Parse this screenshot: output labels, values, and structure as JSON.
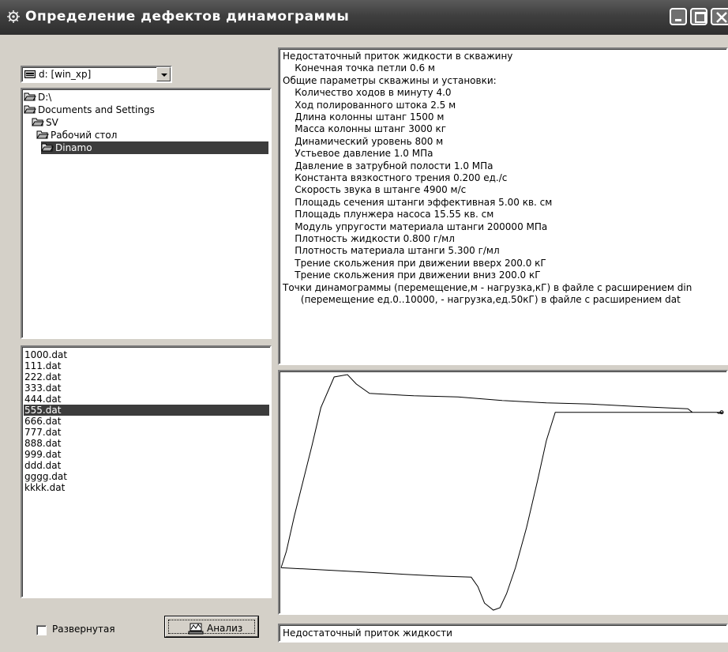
{
  "window": {
    "title": "Определение дефектов динамограммы",
    "colors": {
      "titlebar": "#3f3f3f",
      "face": "#d4d0c8",
      "selection": "#3c3c3c"
    }
  },
  "drive": {
    "value": "d: [win_xp]",
    "icon": "drive-icon"
  },
  "directories": [
    {
      "label": "D:\\",
      "icon": "folder-open-icon",
      "selected": false
    },
    {
      "label": "Documents and Settings",
      "icon": "folder-open-icon",
      "selected": false
    },
    {
      "label": "SV",
      "icon": "folder-open-icon",
      "selected": false
    },
    {
      "label": "Рабочий стол",
      "icon": "folder-open-icon",
      "selected": false
    },
    {
      "label": "Dinamo",
      "icon": "folder-open-icon",
      "selected": true
    }
  ],
  "files": [
    {
      "name": "1000.dat",
      "selected": false
    },
    {
      "name": "111.dat",
      "selected": false
    },
    {
      "name": "222.dat",
      "selected": false
    },
    {
      "name": "333.dat",
      "selected": false
    },
    {
      "name": "444.dat",
      "selected": false
    },
    {
      "name": "555.dat",
      "selected": true
    },
    {
      "name": "666.dat",
      "selected": false
    },
    {
      "name": "777.dat",
      "selected": false
    },
    {
      "name": "888.dat",
      "selected": false
    },
    {
      "name": "999.dat",
      "selected": false
    },
    {
      "name": "ddd.dat",
      "selected": false
    },
    {
      "name": "gggg.dat",
      "selected": false
    },
    {
      "name": "kkkk.dat",
      "selected": false
    }
  ],
  "checkbox": {
    "label": "Развернутая",
    "checked": false
  },
  "analyze_button": {
    "label": "Анализ",
    "icon": "analyze-icon"
  },
  "info_lines": [
    "Недостаточный приток жидкости в скважину",
    "  Конечная точка петли 0.6 м",
    "Общие параметры скважины и установки:",
    "  Количество ходов в минуту 4.0",
    "  Ход полированного штока 2.5 м",
    "  Длина колонны штанг 1500 м",
    "  Масса колонны штанг 3000 кг",
    "  Динамический уровень  800 м",
    "  Устьевое давление 1.0 МПа",
    "  Давление в затрубной полости 1.0 МПа",
    "  Константа вязкостного трения 0.200 ед./с",
    "  Скорость звука в штанге 4900 м/с",
    "  Площадь сечения штанги эффективная 5.00 кв. см",
    "  Площадь плунжера насоса 15.55 кв. см",
    "  Модуль упругости материала штанги 200000 МПа",
    "  Плотность жидкости 0.800 г/мл",
    "  Плотность материала штанги 5.300 г/мл",
    "  Трение скольжения при движении вверх 200.0 кГ",
    "  Трение скольжения при движении вниз 200.0 кГ",
    "Точки динамограммы (перемещение,м - нагрузка,кГ) в файле с расширением din",
    "   (перемещение ед.0..10000, - нагрузка,ед.50кГ) в файле с расширением dat"
  ],
  "result_text": "Недостаточный приток жидкости",
  "chart_data": {
    "type": "line",
    "title": "",
    "xlabel": "",
    "ylabel": "",
    "grid": false,
    "xlim": [
      0,
      1
    ],
    "ylim": [
      0,
      1
    ],
    "series": [
      {
        "values_xy": [
          [
            0.0,
            0.18
          ],
          [
            0.012,
            0.25
          ],
          [
            0.03,
            0.4
          ],
          [
            0.05,
            0.55
          ],
          [
            0.07,
            0.7
          ],
          [
            0.09,
            0.86
          ],
          [
            0.12,
            0.99
          ],
          [
            0.15,
            1.0
          ],
          [
            0.17,
            0.96
          ],
          [
            0.2,
            0.92
          ],
          [
            0.3,
            0.91
          ],
          [
            0.4,
            0.905
          ],
          [
            0.5,
            0.89
          ],
          [
            0.6,
            0.88
          ],
          [
            0.7,
            0.875
          ],
          [
            0.8,
            0.865
          ],
          [
            0.92,
            0.855
          ],
          [
            0.93,
            0.84
          ],
          [
            1.0,
            0.84
          ],
          [
            0.99,
            0.835
          ],
          [
            0.985,
            0.84
          ],
          [
            0.99,
            0.84
          ],
          [
            1.0,
            0.84
          ],
          [
            0.99,
            0.84
          ],
          [
            0.92,
            0.84
          ],
          [
            0.95,
            0.84
          ],
          [
            0.96,
            0.84
          ],
          [
            0.96,
            0.84
          ],
          [
            0.62,
            0.84
          ],
          [
            0.6,
            0.72
          ],
          [
            0.58,
            0.55
          ],
          [
            0.555,
            0.35
          ],
          [
            0.53,
            0.18
          ],
          [
            0.51,
            0.07
          ],
          [
            0.495,
            0.01
          ],
          [
            0.48,
            0.0
          ],
          [
            0.46,
            0.03
          ],
          [
            0.445,
            0.1
          ],
          [
            0.43,
            0.14
          ],
          [
            0.35,
            0.145
          ],
          [
            0.25,
            0.155
          ],
          [
            0.15,
            0.165
          ],
          [
            0.05,
            0.175
          ],
          [
            0.0,
            0.18
          ]
        ]
      }
    ]
  }
}
